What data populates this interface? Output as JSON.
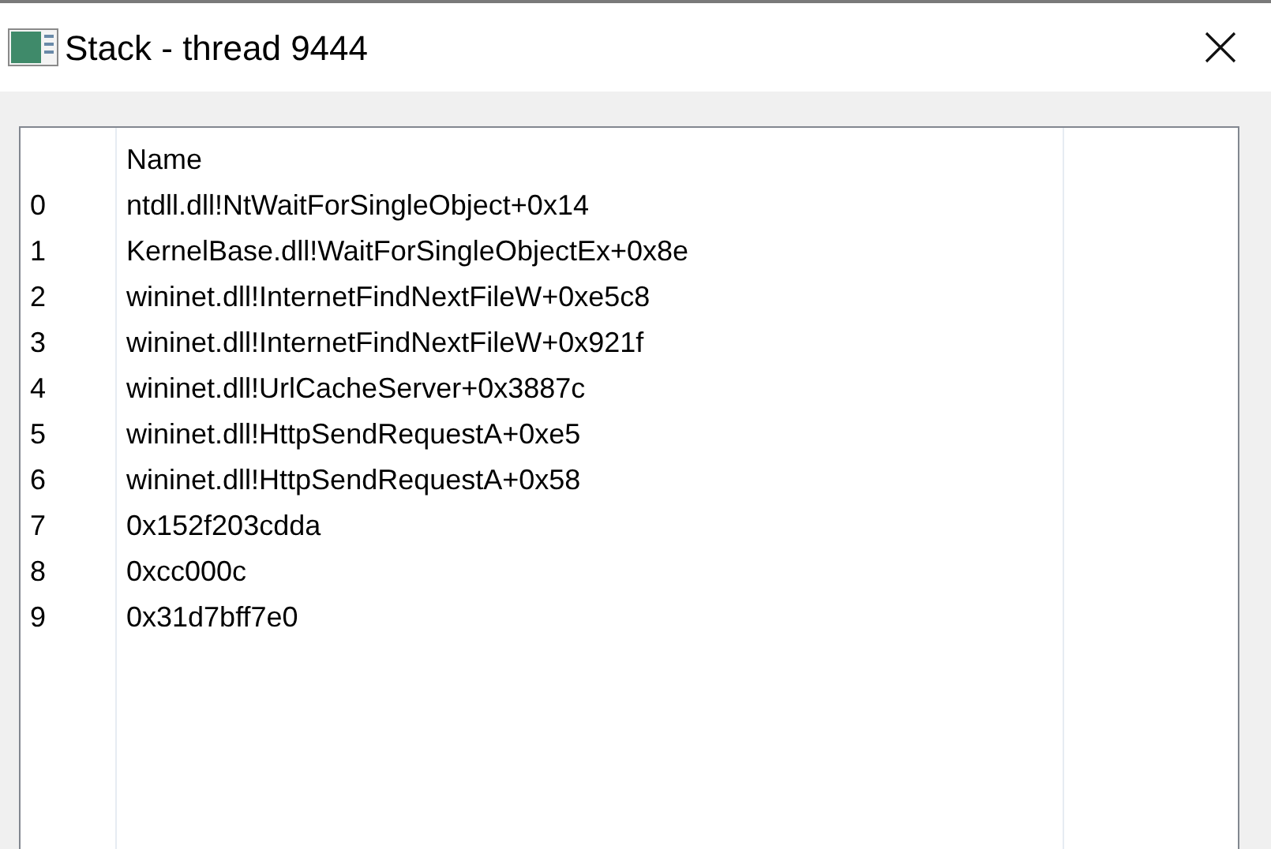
{
  "window": {
    "title": "Stack - thread 9444"
  },
  "table": {
    "columns": [
      "Name"
    ],
    "rows": [
      {
        "index": "0",
        "name": "ntdll.dll!NtWaitForSingleObject+0x14"
      },
      {
        "index": "1",
        "name": "KernelBase.dll!WaitForSingleObjectEx+0x8e"
      },
      {
        "index": "2",
        "name": "wininet.dll!InternetFindNextFileW+0xe5c8"
      },
      {
        "index": "3",
        "name": "wininet.dll!InternetFindNextFileW+0x921f"
      },
      {
        "index": "4",
        "name": "wininet.dll!UrlCacheServer+0x3887c"
      },
      {
        "index": "5",
        "name": "wininet.dll!HttpSendRequestA+0xe5"
      },
      {
        "index": "6",
        "name": "wininet.dll!HttpSendRequestA+0x58"
      },
      {
        "index": "7",
        "name": "0x152f203cdda"
      },
      {
        "index": "8",
        "name": "0xcc000c"
      },
      {
        "index": "9",
        "name": "0x31d7bff7e0"
      }
    ]
  }
}
